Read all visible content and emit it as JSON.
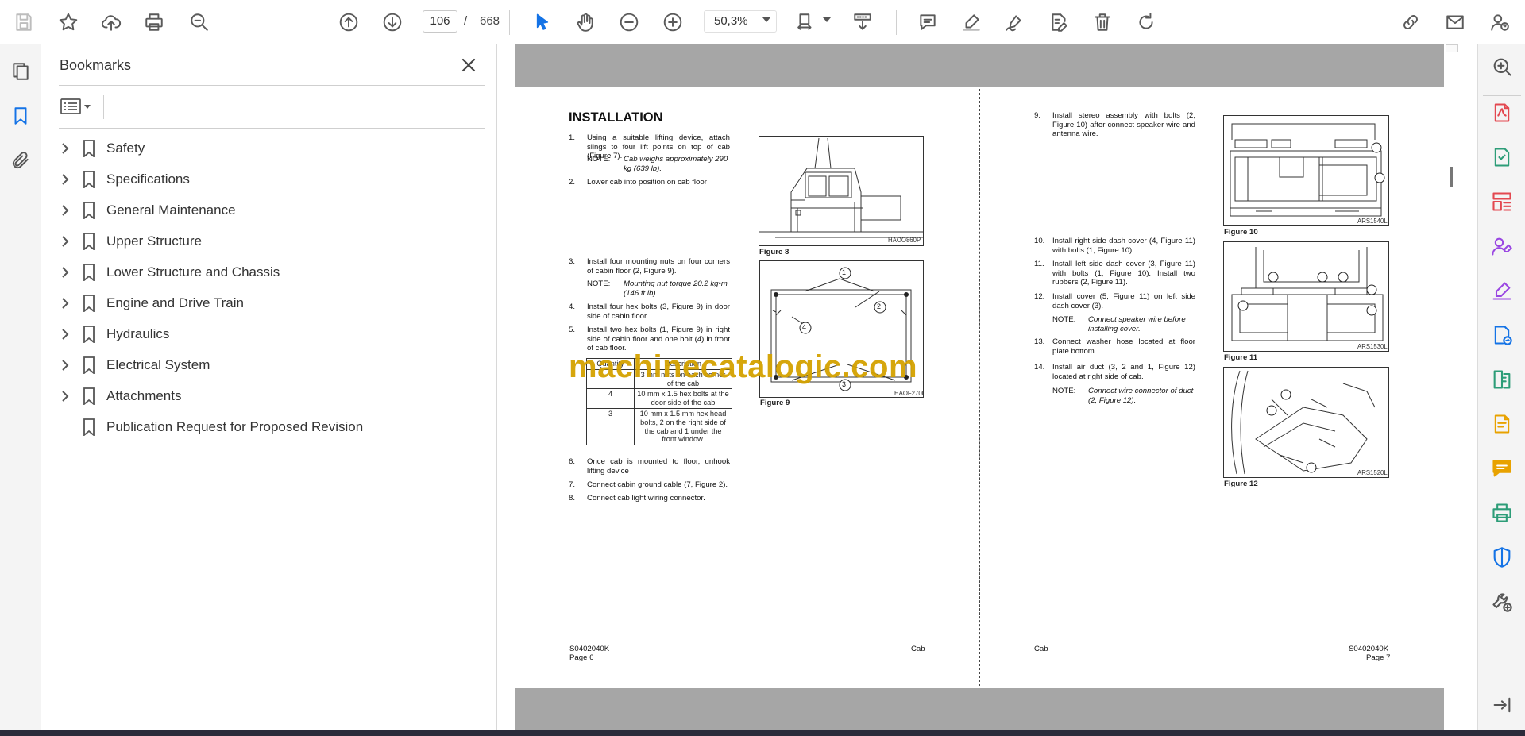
{
  "toolbar": {
    "page_current": "106",
    "page_separator": "/",
    "page_total": "668",
    "zoom": "50,3%"
  },
  "bookmarks": {
    "title": "Bookmarks",
    "items": [
      {
        "label": "Safety",
        "expandable": true
      },
      {
        "label": "Specifications",
        "expandable": true
      },
      {
        "label": "General Maintenance",
        "expandable": true
      },
      {
        "label": "Upper Structure",
        "expandable": true
      },
      {
        "label": "Lower Structure and Chassis",
        "expandable": true
      },
      {
        "label": "Engine and Drive Train",
        "expandable": true
      },
      {
        "label": "Hydraulics",
        "expandable": true
      },
      {
        "label": "Electrical System",
        "expandable": true
      },
      {
        "label": "Attachments",
        "expandable": true
      },
      {
        "label": "Publication Request for Proposed Revision",
        "expandable": false
      }
    ]
  },
  "doc": {
    "heading": "INSTALLATION",
    "left_steps": [
      {
        "n": "1.",
        "text": "Using a suitable lifting device, attach slings to four lift points on top of cab (Figure 7)."
      },
      {
        "n": "2.",
        "text": "Lower cab into position on cab floor"
      },
      {
        "n": "3.",
        "text": "Install four mounting nuts on four corners of cabin floor (2, Figure 9)."
      },
      {
        "n": "4.",
        "text": "Install four hex bolts (3, Figure 9) in door side of cabin floor."
      },
      {
        "n": "5.",
        "text": "Install two hex bolts (1, Figure 9) in right side of cabin floor and one bolt (4) in front of cab floor."
      },
      {
        "n": "6.",
        "text": "Once cab is mounted to floor, unhook lifting device"
      },
      {
        "n": "7.",
        "text": "Connect cabin ground cable (7, Figure 2)."
      },
      {
        "n": "8.",
        "text": "Connect cab light wiring connector."
      }
    ],
    "note_label": "NOTE:",
    "note1": "Cab weighs approximately 290 kg (639 lb).",
    "note2": "Mounting nut torque 20.2 kg•m (146 ft lb)",
    "table": {
      "headers": [
        "Quantity",
        "Description"
      ],
      "rows": [
        {
          "q": "",
          "d": "3 mm nuts on each corner of the cab"
        },
        {
          "q": "4",
          "d": "10 mm x 1.5 hex bolts at the door side of the cab"
        },
        {
          "q": "3",
          "d": "10 mm x 1.5 mm hex head bolts, 2 on the right side of the cab and 1 under the front window."
        }
      ]
    },
    "fig8": {
      "caption": "Figure 8",
      "code": "HAOO860P"
    },
    "fig9": {
      "caption": "Figure 9",
      "code": "HAOF270L",
      "callouts": [
        "1",
        "2",
        "3",
        "4"
      ]
    },
    "right_steps": [
      {
        "n": "9.",
        "text": "Install stereo assembly with bolts (2, Figure 10) after connect speaker wire and antenna wire."
      },
      {
        "n": "10.",
        "text": "Install right side dash cover (4, Figure 11) with bolts (1, Figure 10)."
      },
      {
        "n": "11.",
        "text": "Install left side dash cover (3, Figure 11) with bolts (1, Figure 10). Install two rubbers (2, Figure 11)."
      },
      {
        "n": "12.",
        "text": "Install cover (5, Figure 11) on left side dash cover (3)."
      },
      {
        "n": "13.",
        "text": "Connect washer hose located at floor plate bottom."
      },
      {
        "n": "14.",
        "text": "Install air duct (3, 2 and 1, Figure 12) located at right side of cab."
      }
    ],
    "note3": "Connect speaker wire before installing cover.",
    "note4": "Connect wire connector of duct (2, Figure 12).",
    "fig10": {
      "caption": "Figure 10",
      "code": "ARS1540L"
    },
    "fig11": {
      "caption": "Figure 11",
      "code": "ARS1530L"
    },
    "fig12": {
      "caption": "Figure 12",
      "code": "ARS1520L"
    },
    "footer_left_code": "S0402040K",
    "footer_left_page": "Page 6",
    "footer_left_section": "Cab",
    "footer_right_section": "Cab",
    "footer_right_code": "S0402040K",
    "footer_right_page": "Page 7",
    "watermark": "machinecatalogic.com"
  },
  "icons": {
    "accent": "#1473e6",
    "watermark_color": "#d4a200"
  }
}
